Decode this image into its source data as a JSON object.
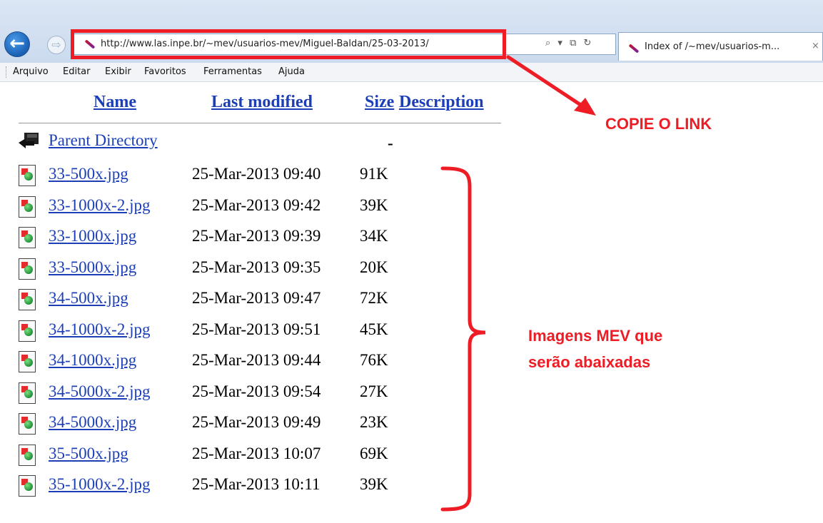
{
  "browser": {
    "url": "http://www.las.inpe.br/~mev/usuarios-mev/Miguel-Baldan/25-03-2013/",
    "tab_title": "Index of /~mev/usuarios-m...",
    "tab_close": "×",
    "back_glyph": "←",
    "forward_glyph": "⇨",
    "address_buttons": {
      "search": "⌕",
      "dropdown": "▾",
      "compat": "⧉",
      "refresh": "↻"
    },
    "favicon": "feather-icon"
  },
  "menu": [
    "Arquivo",
    "Editar",
    "Exibir",
    "Favoritos",
    "Ferramentas",
    "Ajuda"
  ],
  "listing": {
    "headers": {
      "name": "Name",
      "last_modified": "Last modified",
      "size": "Size",
      "description": "Description"
    },
    "parent": {
      "label": "Parent Directory",
      "size": "-"
    },
    "files": [
      {
        "name": "33-500x.jpg",
        "modified": "25-Mar-2013 09:40",
        "size": "91K"
      },
      {
        "name": "33-1000x-2.jpg",
        "modified": "25-Mar-2013 09:42",
        "size": "39K"
      },
      {
        "name": "33-1000x.jpg",
        "modified": "25-Mar-2013 09:39",
        "size": "34K"
      },
      {
        "name": "33-5000x.jpg",
        "modified": "25-Mar-2013 09:35",
        "size": "20K"
      },
      {
        "name": "34-500x.jpg",
        "modified": "25-Mar-2013 09:47",
        "size": "72K"
      },
      {
        "name": "34-1000x-2.jpg",
        "modified": "25-Mar-2013 09:51",
        "size": "45K"
      },
      {
        "name": "34-1000x.jpg",
        "modified": "25-Mar-2013 09:44",
        "size": "76K"
      },
      {
        "name": "34-5000x-2.jpg",
        "modified": "25-Mar-2013 09:54",
        "size": "27K"
      },
      {
        "name": "34-5000x.jpg",
        "modified": "25-Mar-2013 09:49",
        "size": "23K"
      },
      {
        "name": "35-500x.jpg",
        "modified": "25-Mar-2013 10:07",
        "size": "69K"
      },
      {
        "name": "35-1000x-2.jpg",
        "modified": "25-Mar-2013 10:11",
        "size": "39K"
      }
    ],
    "file_icon": "image-file-icon",
    "parent_icon": "back-folder-icon"
  },
  "annotations": {
    "copy_link": "COPIE O LINK",
    "images_line1": "Imagens MEV que",
    "images_line2": "serão abaixadas",
    "color": "#ee1c25"
  }
}
